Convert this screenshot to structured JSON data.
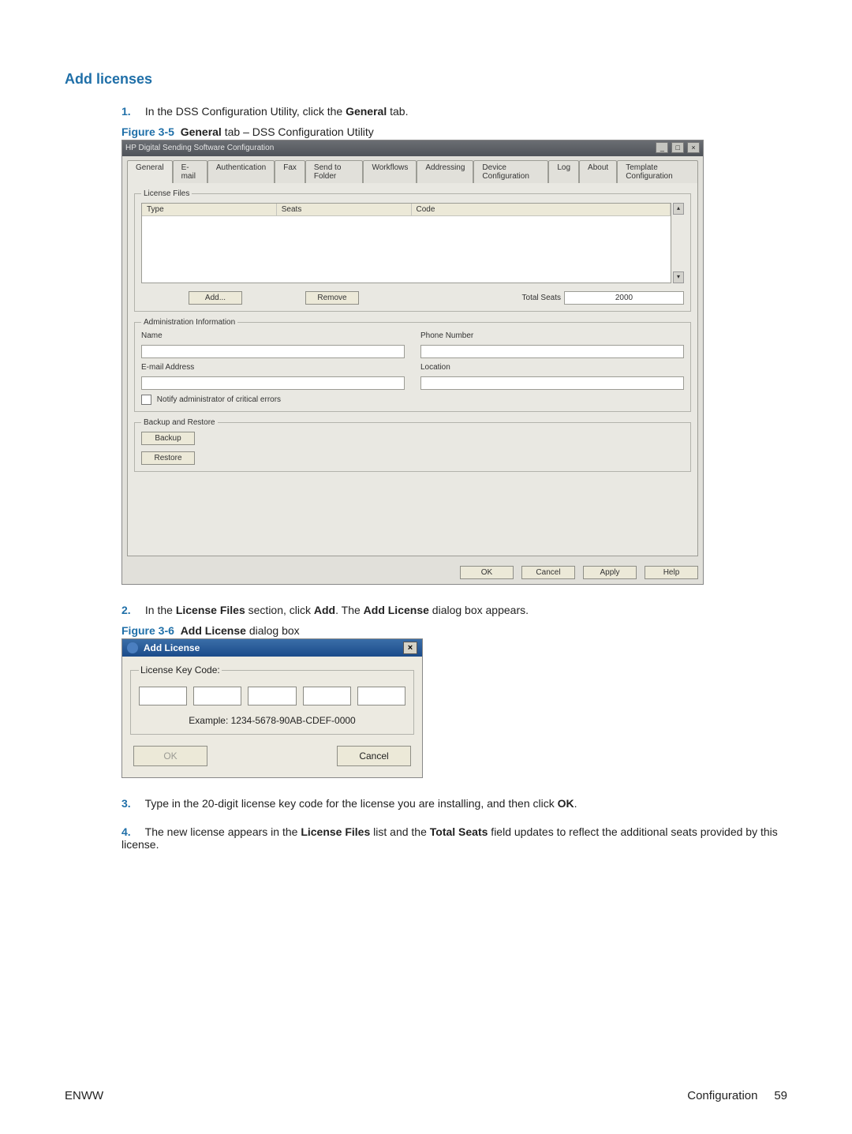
{
  "section_title": "Add licenses",
  "steps": [
    {
      "num": "1.",
      "text_before": "In the DSS Configuration Utility, click the ",
      "bold1": "General",
      "text_after": " tab."
    },
    {
      "num": "2.",
      "text_before": "In the ",
      "bold1": "License Files",
      "mid1": " section, click ",
      "bold2": "Add",
      "mid2": ". The ",
      "bold3": "Add License",
      "text_after": " dialog box appears."
    },
    {
      "num": "3.",
      "text_before": "Type in the 20-digit license key code for the license you are installing, and then click ",
      "bold1": "OK",
      "text_after": "."
    },
    {
      "num": "4.",
      "text_before": "The new license appears in the ",
      "bold1": "License Files",
      "mid1": " list and the ",
      "bold2": "Total Seats",
      "text_after": " field updates to reflect the additional seats provided by this license."
    }
  ],
  "fig35": {
    "caption_label": "Figure 3-5",
    "caption_title": "General",
    "caption_suffix": " tab – DSS Configuration Utility",
    "window_title": "HP Digital Sending Software Configuration",
    "tabs": [
      "General",
      "E-mail",
      "Authentication",
      "Fax",
      "Send to Folder",
      "Workflows",
      "Addressing",
      "Device Configuration",
      "Log",
      "About",
      "Template Configuration"
    ],
    "active_tab_index": 0,
    "license_files": {
      "legend": "License Files",
      "columns": [
        "Type",
        "Seats",
        "Code"
      ],
      "add_btn": "Add...",
      "remove_btn": "Remove",
      "total_seats_label": "Total Seats",
      "total_seats_value": "2000"
    },
    "admin_info": {
      "legend": "Administration Information",
      "name_label": "Name",
      "phone_label": "Phone Number",
      "email_label": "E-mail Address",
      "location_label": "Location",
      "notify_label": "Notify administrator of critical errors"
    },
    "backup_restore": {
      "legend": "Backup and Restore",
      "backup_btn": "Backup",
      "restore_btn": "Restore"
    },
    "bottom_buttons": [
      "OK",
      "Cancel",
      "Apply",
      "Help"
    ]
  },
  "fig36": {
    "caption_label": "Figure 3-6",
    "caption_title": "Add License",
    "caption_suffix": " dialog box",
    "window_title": "Add License",
    "legend": "License Key Code:",
    "example": "Example: 1234-5678-90AB-CDEF-0000",
    "ok_btn": "OK",
    "cancel_btn": "Cancel"
  },
  "footer": {
    "left": "ENWW",
    "right_label": "Configuration",
    "page_no": "59"
  }
}
